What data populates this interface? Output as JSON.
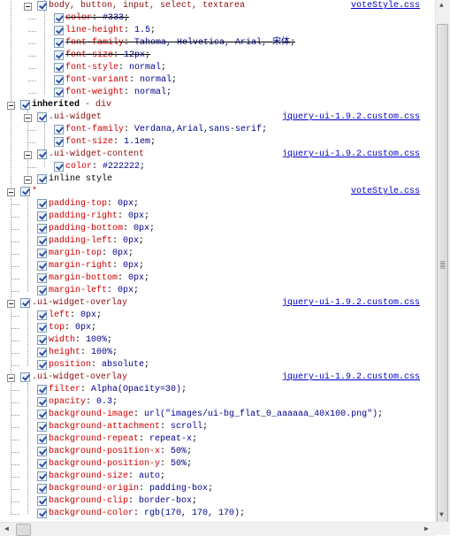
{
  "rows": [
    {
      "level": 2,
      "kind": "rule",
      "selector": "body, button, input, select, textarea",
      "source": "voteStyle.css"
    },
    {
      "level": 3,
      "kind": "prop",
      "name": "color",
      "value": "#333",
      "overridden": true
    },
    {
      "level": 3,
      "kind": "prop",
      "name": "line-height",
      "value": "1.5"
    },
    {
      "level": 3,
      "kind": "prop",
      "name": "font-family",
      "value": "Tahoma, Helvetica, Arial, 宋体",
      "overridden": true
    },
    {
      "level": 3,
      "kind": "prop",
      "name": "font-size",
      "value": "12px",
      "overridden": true
    },
    {
      "level": 3,
      "kind": "prop",
      "name": "font-style",
      "value": "normal"
    },
    {
      "level": 3,
      "kind": "prop",
      "name": "font-variant",
      "value": "normal"
    },
    {
      "level": 3,
      "kind": "prop",
      "name": "font-weight",
      "value": "normal"
    },
    {
      "level": 1,
      "kind": "inherited",
      "selector": "inherited",
      "sub": " - div"
    },
    {
      "level": 2,
      "kind": "rule",
      "selector": ".ui-widget",
      "source": "jquery-ui-1.9.2.custom.css"
    },
    {
      "level": 3,
      "kind": "prop",
      "name": "font-family",
      "value": "Verdana,Arial,sans-serif"
    },
    {
      "level": 3,
      "kind": "prop",
      "name": "font-size",
      "value": "1.1em"
    },
    {
      "level": 2,
      "kind": "rule",
      "selector": ".ui-widget-content",
      "source": "jquery-ui-1.9.2.custom.css"
    },
    {
      "level": 3,
      "kind": "prop",
      "name": "color",
      "value": "#222222"
    },
    {
      "level": 2,
      "kind": "plain",
      "selector": "inline style"
    },
    {
      "level": 1,
      "kind": "star",
      "selector": "*",
      "source": "voteStyle.css"
    },
    {
      "level": 2,
      "kind": "prop",
      "name": "padding-top",
      "value": "0px"
    },
    {
      "level": 2,
      "kind": "prop",
      "name": "padding-right",
      "value": "0px"
    },
    {
      "level": 2,
      "kind": "prop",
      "name": "padding-bottom",
      "value": "0px"
    },
    {
      "level": 2,
      "kind": "prop",
      "name": "padding-left",
      "value": "0px"
    },
    {
      "level": 2,
      "kind": "prop",
      "name": "margin-top",
      "value": "0px"
    },
    {
      "level": 2,
      "kind": "prop",
      "name": "margin-right",
      "value": "0px"
    },
    {
      "level": 2,
      "kind": "prop",
      "name": "margin-bottom",
      "value": "0px"
    },
    {
      "level": 2,
      "kind": "prop",
      "name": "margin-left",
      "value": "0px"
    },
    {
      "level": 1,
      "kind": "rule",
      "selector": ".ui-widget-overlay",
      "source": "jquery-ui-1.9.2.custom.css"
    },
    {
      "level": 2,
      "kind": "prop",
      "name": "left",
      "value": "0px"
    },
    {
      "level": 2,
      "kind": "prop",
      "name": "top",
      "value": "0px"
    },
    {
      "level": 2,
      "kind": "prop",
      "name": "width",
      "value": "100%"
    },
    {
      "level": 2,
      "kind": "prop",
      "name": "height",
      "value": "100%"
    },
    {
      "level": 2,
      "kind": "prop",
      "name": "position",
      "value": "absolute"
    },
    {
      "level": 1,
      "kind": "rule",
      "selector": ".ui-widget-overlay",
      "source": "jquery-ui-1.9.2.custom.css"
    },
    {
      "level": 2,
      "kind": "prop",
      "name": "filter",
      "value": "Alpha(Opacity=30)"
    },
    {
      "level": 2,
      "kind": "prop",
      "name": "opacity",
      "value": "0.3"
    },
    {
      "level": 2,
      "kind": "prop",
      "name": "background-image",
      "value": "url(\"images/ui-bg_flat_0_aaaaaa_40x100.png\")"
    },
    {
      "level": 2,
      "kind": "prop",
      "name": "background-attachment",
      "value": "scroll"
    },
    {
      "level": 2,
      "kind": "prop",
      "name": "background-repeat",
      "value": "repeat-x"
    },
    {
      "level": 2,
      "kind": "prop",
      "name": "background-position-x",
      "value": "50%"
    },
    {
      "level": 2,
      "kind": "prop",
      "name": "background-position-y",
      "value": "50%"
    },
    {
      "level": 2,
      "kind": "prop",
      "name": "background-size",
      "value": "auto"
    },
    {
      "level": 2,
      "kind": "prop",
      "name": "background-origin",
      "value": "padding-box"
    },
    {
      "level": 2,
      "kind": "prop",
      "name": "background-clip",
      "value": "border-box"
    },
    {
      "level": 2,
      "kind": "prop",
      "name": "background-color",
      "value": "rgb(170, 170, 170)"
    }
  ],
  "punct": {
    "colon": ": ",
    "semi": ";"
  },
  "scrollbar": {
    "vertical_grip": "≡",
    "up": "▲",
    "down": "▼",
    "left": "◀",
    "right": "▶"
  }
}
